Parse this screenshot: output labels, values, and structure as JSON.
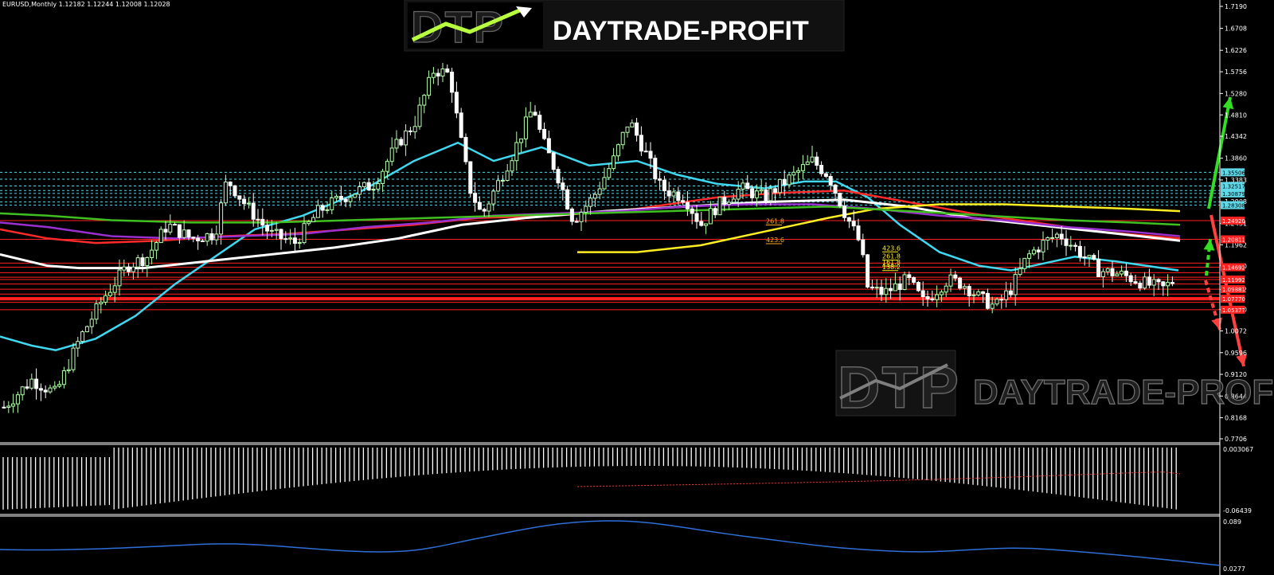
{
  "header": {
    "symbol_line": "EURUSD,Monthly  1.12182 1.12244 1.12008 1.12028"
  },
  "logo_top": {
    "mark": "DTP",
    "name": "DAYTRADE-PROFIT"
  },
  "logo_watermark": {
    "mark": "DTP",
    "name": "DAYTRADE-PROFIT"
  },
  "colors": {
    "bull": "#b8ffb0",
    "bear": "#ffffff",
    "grid_cyan": "#5fd7e6",
    "level_red": "#ff2020",
    "ma_cyan": "#40d8f0",
    "ma_red": "#ff2a2a",
    "ma_white": "#ffffff",
    "ma_yellow": "#ffee22",
    "ma_purple": "#9b30d0",
    "ma_green": "#40c020",
    "osc_blue": "#2f6fd8",
    "arrow_up": "#33dd22",
    "arrow_down": "#ff4040"
  },
  "chart_data": {
    "type": "candlestick",
    "symbol": "EURUSD",
    "timeframe": "Monthly",
    "ylim": [
      0.7706,
      1.719
    ],
    "price_axis_ticks": [
      "1.7190",
      "1.6708",
      "1.6226",
      "1.5756",
      "1.5280",
      "1.4810",
      "1.4342",
      "1.3860",
      "1.3383",
      "1.2908",
      "1.2431",
      "1.1962",
      "1.1500",
      "1.0982",
      "1.0540",
      "1.0072",
      "0.9596",
      "0.9120",
      "0.8644",
      "0.8168",
      "0.7706"
    ],
    "level_labels_cyan": [
      "1.35506",
      "1.32517",
      "1.30879",
      "1.28308"
    ],
    "level_labels_red": [
      "1.24920",
      "1.20811",
      "1.14692",
      "1.11992",
      "1.09881",
      "1.07770",
      "1.05377"
    ],
    "fib_labels": [
      "261.8",
      "423.6",
      "423.6",
      "261.8",
      "161.8",
      "138.2"
    ],
    "fib_price_levels": [
      1.243,
      1.202,
      1.184,
      1.166,
      1.153,
      1.143
    ],
    "oscillator_1": {
      "ticks": [
        "0.003067",
        "-0.06439"
      ]
    },
    "oscillator_2": {
      "ticks": [
        "0.089",
        "0.0277"
      ]
    },
    "cyan_levels": [
      1.35506,
      1.34,
      1.32517,
      1.315,
      1.30879,
      1.3,
      1.29,
      1.28308
    ],
    "red_levels": [
      1.2492,
      1.20811,
      1.156,
      1.14692,
      1.135,
      1.125,
      1.11992,
      1.11,
      1.09881,
      1.088,
      1.0805,
      1.0777,
      1.07,
      1.05377
    ]
  }
}
